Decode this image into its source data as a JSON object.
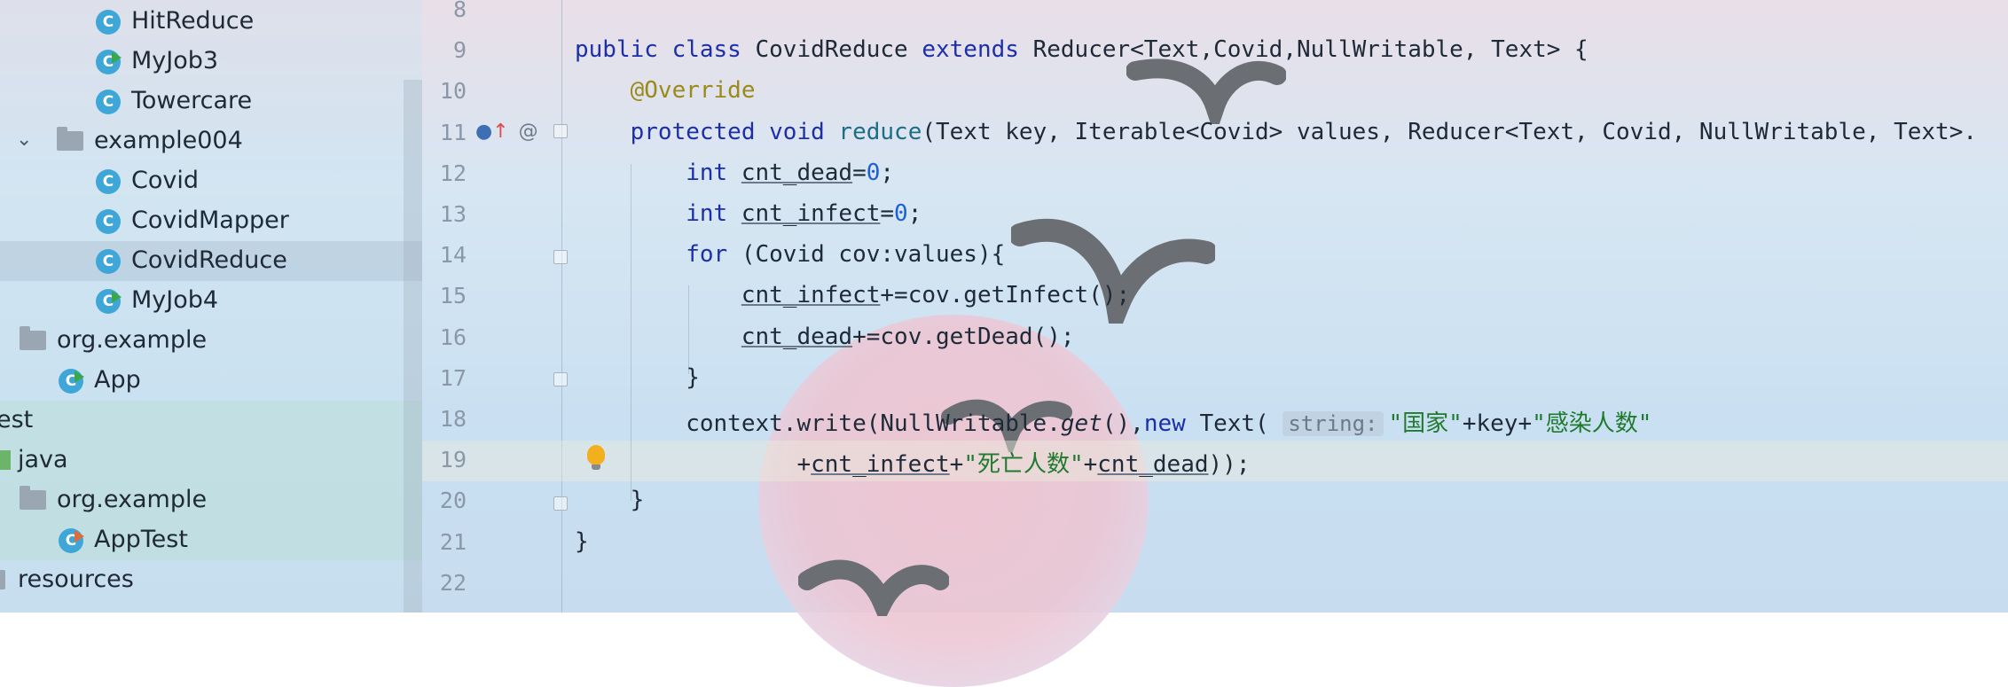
{
  "tree": {
    "items": [
      {
        "label": "HitReduce",
        "type": "class"
      },
      {
        "label": "MyJob3",
        "type": "runnable"
      },
      {
        "label": "Towercare",
        "type": "class"
      },
      {
        "label": "example004",
        "type": "package"
      },
      {
        "label": "Covid",
        "type": "class"
      },
      {
        "label": "CovidMapper",
        "type": "class"
      },
      {
        "label": "CovidReduce",
        "type": "class",
        "selected": true
      },
      {
        "label": "MyJob4",
        "type": "runnable"
      },
      {
        "label": "org.example",
        "type": "package"
      },
      {
        "label": "App",
        "type": "runnable"
      },
      {
        "label": "est",
        "type": "text"
      },
      {
        "label": "java",
        "type": "source-folder"
      },
      {
        "label": "org.example",
        "type": "package"
      },
      {
        "label": "AppTest",
        "type": "test"
      },
      {
        "label": "resources",
        "type": "folder"
      }
    ]
  },
  "editor": {
    "lines": [
      {
        "n": "8"
      },
      {
        "n": "9",
        "segs": [
          [
            "kw",
            "public class "
          ],
          [
            "",
            "CovidReduce "
          ],
          [
            "kw",
            "extends "
          ],
          [
            "",
            "Reducer<Text,Covid,NullWritable, Text> {"
          ]
        ]
      },
      {
        "n": "10",
        "segs": [
          [
            "ann",
            "    @Override"
          ]
        ]
      },
      {
        "n": "11",
        "segs": [
          [
            "kw",
            "    protected void "
          ],
          [
            "mth",
            "reduce"
          ],
          [
            "",
            "(Text key, Iterable<Covid> values, Reducer<Text, Covid, NullWritable, Text>."
          ]
        ]
      },
      {
        "n": "12",
        "segs": [
          [
            "kw",
            "        int "
          ],
          [
            "ul",
            "cnt_dead"
          ],
          [
            "",
            "="
          ],
          [
            "num",
            "0"
          ],
          [
            "",
            ";"
          ]
        ]
      },
      {
        "n": "13",
        "segs": [
          [
            "kw",
            "        int "
          ],
          [
            "ul",
            "cnt_infect"
          ],
          [
            "",
            "="
          ],
          [
            "num",
            "0"
          ],
          [
            "",
            ";"
          ]
        ]
      },
      {
        "n": "14",
        "segs": [
          [
            "kw",
            "        for "
          ],
          [
            "",
            "(Covid cov:values){"
          ]
        ]
      },
      {
        "n": "15",
        "segs": [
          [
            "",
            "            "
          ],
          [
            "ul",
            "cnt_infect"
          ],
          [
            "",
            "+=cov.getInfect();"
          ]
        ]
      },
      {
        "n": "16",
        "segs": [
          [
            "",
            "            "
          ],
          [
            "ul",
            "cnt_dead"
          ],
          [
            "",
            "+=cov.getDead();"
          ]
        ]
      },
      {
        "n": "17",
        "segs": [
          [
            "",
            "        }"
          ]
        ]
      },
      {
        "n": "18",
        "segs": [
          [
            "",
            "        context.write(NullWritable."
          ],
          [
            "it",
            "get"
          ],
          [
            "",
            "(),"
          ],
          [
            "kw",
            "new "
          ],
          [
            "",
            "Text( "
          ],
          [
            "hint",
            "string:"
          ],
          [
            "str",
            "\"国家\""
          ],
          [
            "",
            "+key+"
          ],
          [
            "str",
            "\"感染人数\""
          ]
        ]
      },
      {
        "n": "19",
        "segs": [
          [
            "",
            "                +"
          ],
          [
            "ul",
            "cnt_infect"
          ],
          [
            "",
            "+"
          ],
          [
            "str",
            "\"死亡人数\""
          ],
          [
            "",
            "+"
          ],
          [
            "ul",
            "cnt_dead"
          ],
          [
            "",
            "));"
          ]
        ]
      },
      {
        "n": "20",
        "segs": [
          [
            "",
            "    }"
          ]
        ]
      },
      {
        "n": "21",
        "segs": [
          [
            "",
            "}"
          ]
        ]
      },
      {
        "n": "22"
      }
    ]
  },
  "colors": {
    "keyword": "#1c2fa8",
    "string": "#1f7a2e",
    "number": "#1b5fd8",
    "annotation": "#9a8a1a",
    "line_number": "#8a98a8"
  }
}
